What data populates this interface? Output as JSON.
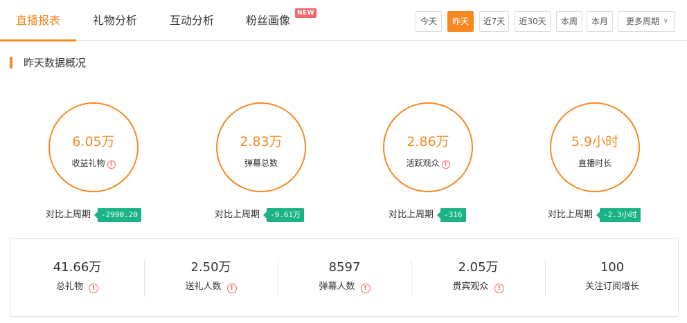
{
  "tabs": [
    {
      "label": "直播报表",
      "active": true
    },
    {
      "label": "礼物分析",
      "active": false
    },
    {
      "label": "互动分析",
      "active": false
    },
    {
      "label": "粉丝画像",
      "active": false,
      "badge": "NEW"
    }
  ],
  "periods": [
    {
      "label": "今天",
      "active": false
    },
    {
      "label": "昨天",
      "active": true
    },
    {
      "label": "近7天",
      "active": false
    },
    {
      "label": "近30天",
      "active": false
    },
    {
      "label": "本周",
      "active": false
    },
    {
      "label": "本月",
      "active": false
    }
  ],
  "more_periods": {
    "label": "更多周期"
  },
  "section": {
    "title": "昨天数据概况"
  },
  "metrics": [
    {
      "value": "6.05万",
      "label": "收益礼物",
      "has_info": true,
      "compare_label": "对比上周期",
      "compare_value": "-2990.20"
    },
    {
      "value": "2.83万",
      "label": "弹幕总数",
      "has_info": false,
      "compare_label": "对比上周期",
      "compare_value": "-9.61万"
    },
    {
      "value": "2.86万",
      "label": "活跃观众",
      "has_info": true,
      "compare_label": "对比上周期",
      "compare_value": "-316"
    },
    {
      "value": "5.9小时",
      "label": "直播时长",
      "has_info": false,
      "compare_label": "对比上周期",
      "compare_value": "-2.3小时"
    }
  ],
  "stats": [
    {
      "value": "41.66万",
      "label": "总礼物",
      "has_info": true
    },
    {
      "value": "2.50万",
      "label": "送礼人数",
      "has_info": true
    },
    {
      "value": "8597",
      "label": "弹幕人数",
      "has_info": true
    },
    {
      "value": "2.05万",
      "label": "贵宾观众",
      "has_info": true
    },
    {
      "value": "100",
      "label": "关注订阅增长",
      "has_info": false
    }
  ],
  "icons": {
    "info": "!",
    "chevron": "∨"
  },
  "colors": {
    "accent": "#f5891f",
    "badge_green": "#1ab385",
    "info_red": "#f3676a",
    "new_badge": "#f3676a"
  }
}
